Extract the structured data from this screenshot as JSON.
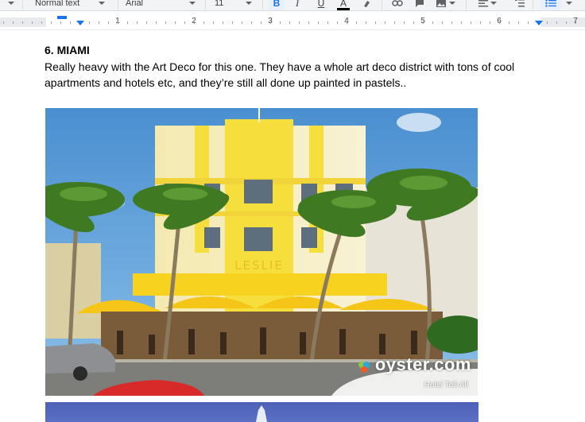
{
  "toolbar": {
    "style_label": "Normal text",
    "font_label": "Arial",
    "size_label": "11",
    "bold_label": "B",
    "italic_label": "I",
    "underline_label": "U",
    "text_color_label": "A"
  },
  "ruler": {
    "numbers": [
      "1",
      "2",
      "3",
      "4",
      "5",
      "6",
      "7"
    ]
  },
  "document": {
    "heading": "6. MIAMI",
    "paragraph": "Really heavy with the Art Deco for this one.  They have a whole art deco district with tons of cool apartments and hotels etc, and they’re still all done up painted in pastels.."
  },
  "photo": {
    "sign_text": "LESLIE",
    "watermark": "oyster.com",
    "watermark_sub": "Hotel Tell-All"
  },
  "colors": {
    "accent": "#1a73e8",
    "building_yellow": "#f7e04a",
    "sky": "#5c9fd8"
  }
}
